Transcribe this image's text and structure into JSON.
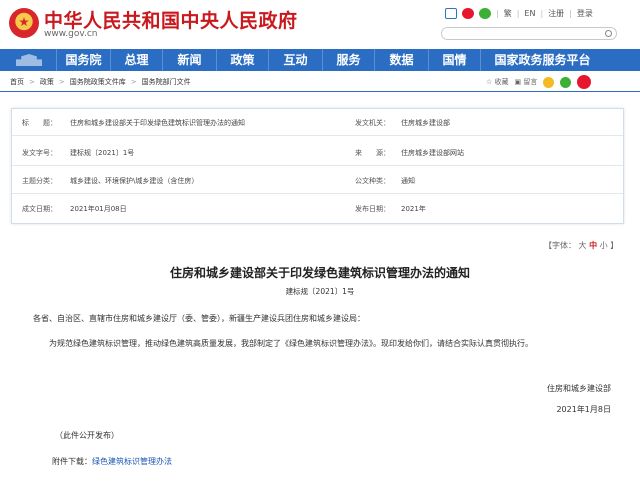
{
  "header": {
    "site_title": "中华人民共和国中央人民政府",
    "site_url": "www.gov.cn",
    "links": [
      "繁",
      "EN",
      "注册",
      "登录"
    ],
    "icons": [
      "app-icon",
      "weibo-icon",
      "wechat-icon"
    ]
  },
  "nav": {
    "items": [
      "国务院",
      "总理",
      "新闻",
      "政策",
      "互动",
      "服务",
      "数据",
      "国情",
      "国家政务服务平台"
    ]
  },
  "breadcrumb": {
    "items": [
      "首页",
      "政策",
      "国务院政策文件库",
      "国务院部门文件"
    ]
  },
  "share": {
    "favorite": "收藏",
    "print": "留言"
  },
  "info": {
    "title_label": "标　　题：",
    "title_value": "住房和城乡建设部关于印发绿色建筑标识管理办法的通知",
    "issuer_label": "发文机关：",
    "issuer_value": "住房城乡建设部",
    "doc_no_label": "发文字号：",
    "doc_no_value": "建标规〔2021〕1号",
    "source_label": "来　　源：",
    "source_value": "住房城乡建设部网站",
    "topic_label": "主题分类：",
    "topic_value": "城乡建设、环境保护\\城乡建设（含住房）",
    "type_label": "公文种类：",
    "type_value": "通知",
    "date_label": "成文日期：",
    "date_value": "2021年01月08日",
    "pub_label": "发布日期：",
    "pub_value": "2021年"
  },
  "font_control": {
    "prefix": "【字体：",
    "large": "大",
    "medium": "中",
    "small": "小",
    "suffix": "】"
  },
  "document": {
    "title": "住房和城乡建设部关于印发绿色建筑标识管理办法的通知",
    "number": "建标规〔2021〕1号",
    "salutation": "各省、自治区、直辖市住房和城乡建设厅（委、管委），新疆生产建设兵团住房和城乡建设局：",
    "body": "为规范绿色建筑标识管理，推动绿色建筑高质量发展，我部制定了《绿色建筑标识管理办法》。现印发给你们，请结合实际认真贯彻执行。",
    "signature": "住房和城乡建设部",
    "date": "2021年1月8日",
    "public_note": "（此件公开发布）",
    "attachment_label": "附件下载：",
    "attachment_link": "绿色建筑标识管理办法"
  },
  "colors": {
    "brand_red": "#c9191e",
    "nav_blue": "#2a6dc2",
    "link_blue": "#1a55b0"
  }
}
